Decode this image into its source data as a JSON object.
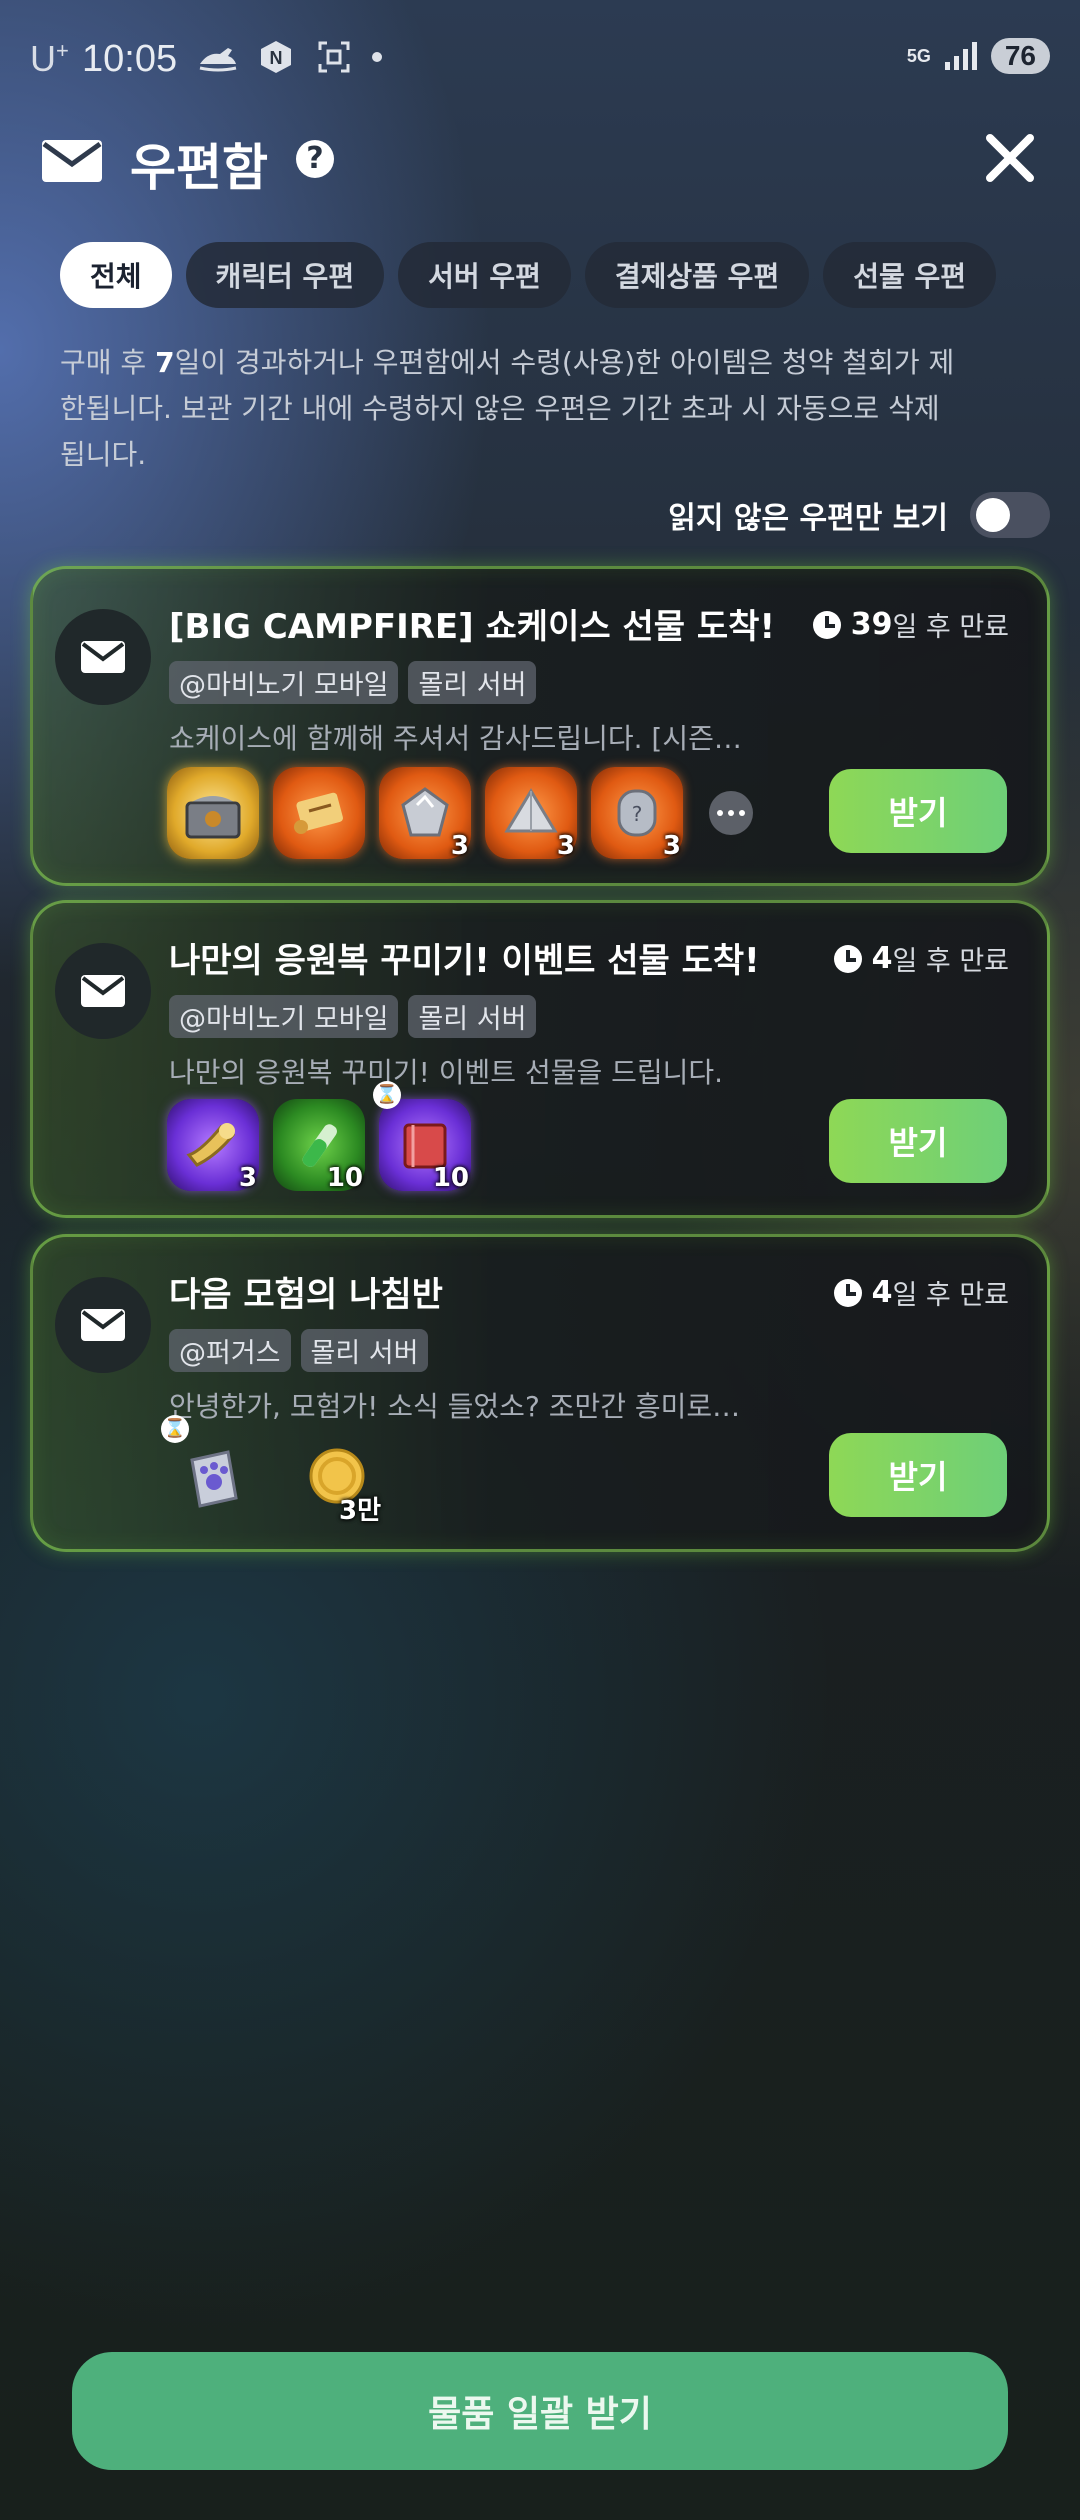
{
  "status_bar": {
    "carrier": "U",
    "carrier_sup": "+",
    "time": "10:05",
    "network": "5G",
    "battery": "76",
    "icons": [
      "jet-ski-icon",
      "n-app-icon",
      "screenshot-icon",
      "dot-icon",
      "signal-icon"
    ]
  },
  "header": {
    "title": "우편함",
    "help": "?"
  },
  "tabs": [
    {
      "label": "전체",
      "active": true
    },
    {
      "label": "캐릭터 우편",
      "active": false
    },
    {
      "label": "서버 우편",
      "active": false
    },
    {
      "label": "결제상품 우편",
      "active": false
    },
    {
      "label": "선물 우편",
      "active": false
    }
  ],
  "notice": {
    "part1": "구매 후 ",
    "bold": "7",
    "part2": "일이 경과하거나 우편함에서 수령(사용)한 아이템은 청약 철회가 제한됩니다. 보관 기간 내에 수령하지 않은 우편은 기간 초과 시 자동으로 삭제됩니다."
  },
  "unread_toggle": {
    "label": "읽지 않은 우편만 보기",
    "on": false
  },
  "mails": [
    {
      "title": "[BIG CAMPFIRE] 쇼케이스 선물 도착!",
      "expire_num": "39",
      "expire_text": "일 후 만료",
      "tags": [
        "@마비노기 모바일",
        "몰리 서버"
      ],
      "desc": "쇼케이스에 함께해 주셔서 감사드립니다. [시즌…",
      "items": [
        {
          "name": "treasure-chest-icon",
          "grade": "gold",
          "count": ""
        },
        {
          "name": "scroll-icon",
          "grade": "orange",
          "count": ""
        },
        {
          "name": "gem-stone-icon",
          "grade": "orange",
          "count": "3"
        },
        {
          "name": "ore-stone-icon",
          "grade": "orange",
          "count": "3"
        },
        {
          "name": "rune-stone-icon",
          "grade": "orange",
          "count": "3"
        }
      ],
      "has_more": true,
      "claim": "받기"
    },
    {
      "title": "나만의 응원복 꾸미기! 이벤트 선물 도착!",
      "expire_num": "4",
      "expire_text": "일 후 만료",
      "tags": [
        "@마비노기 모바일",
        "몰리 서버"
      ],
      "desc": "나만의 응원복 꾸미기! 이벤트 선물을 드립니다.",
      "items": [
        {
          "name": "horn-icon",
          "grade": "purple",
          "count": "3"
        },
        {
          "name": "potion-vial-icon",
          "grade": "green",
          "count": "10"
        },
        {
          "name": "dye-book-icon",
          "grade": "purple",
          "count": "10",
          "timer": true
        }
      ],
      "has_more": false,
      "claim": "받기"
    },
    {
      "title": "다음 모험의 나침반",
      "expire_num": "4",
      "expire_text": "일 후 만료",
      "tags": [
        "@퍼거스",
        "몰리 서버"
      ],
      "desc": "안녕한가, 모험가! 소식 들었소? 조만간 흥미로…",
      "items": [
        {
          "name": "paw-map-icon",
          "grade": "plain",
          "count": "",
          "timer": true
        },
        {
          "name": "gold-coin-icon",
          "grade": "plain",
          "count": "3만"
        }
      ],
      "has_more": false,
      "claim": "받기"
    }
  ],
  "bulk_claim": "물품 일괄 받기"
}
